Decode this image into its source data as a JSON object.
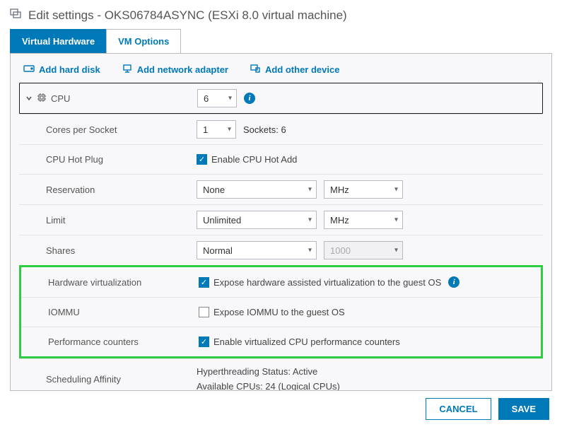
{
  "header": {
    "title": "Edit settings - OKS06784ASYNC (ESXi 8.0 virtual machine)"
  },
  "tabs": {
    "hardware": "Virtual Hardware",
    "options": "VM Options"
  },
  "toolbar": {
    "add_disk": "Add hard disk",
    "add_net": "Add network adapter",
    "add_other": "Add other device"
  },
  "cpu": {
    "label": "CPU",
    "value": "6",
    "cores_label": "Cores per Socket",
    "cores_value": "1",
    "sockets_text": "Sockets: 6",
    "hotplug_label": "CPU Hot Plug",
    "hotplug_check": "Enable CPU Hot Add",
    "reservation_label": "Reservation",
    "reservation_value": "None",
    "reservation_unit": "MHz",
    "limit_label": "Limit",
    "limit_value": "Unlimited",
    "limit_unit": "MHz",
    "shares_label": "Shares",
    "shares_value": "Normal",
    "shares_num": "1000",
    "hwvirt_label": "Hardware virtualization",
    "hwvirt_check": "Expose hardware assisted virtualization to the guest OS",
    "iommu_label": "IOMMU",
    "iommu_check": "Expose IOMMU to the guest OS",
    "perf_label": "Performance counters",
    "perf_check": "Enable virtualized CPU performance counters",
    "sched_label": "Scheduling Affinity",
    "sched_line1": "Hyperthreading Status: Active",
    "sched_line2": "Available CPUs: 24 (Logical CPUs)"
  },
  "footer": {
    "cancel": "CANCEL",
    "save": "SAVE"
  }
}
